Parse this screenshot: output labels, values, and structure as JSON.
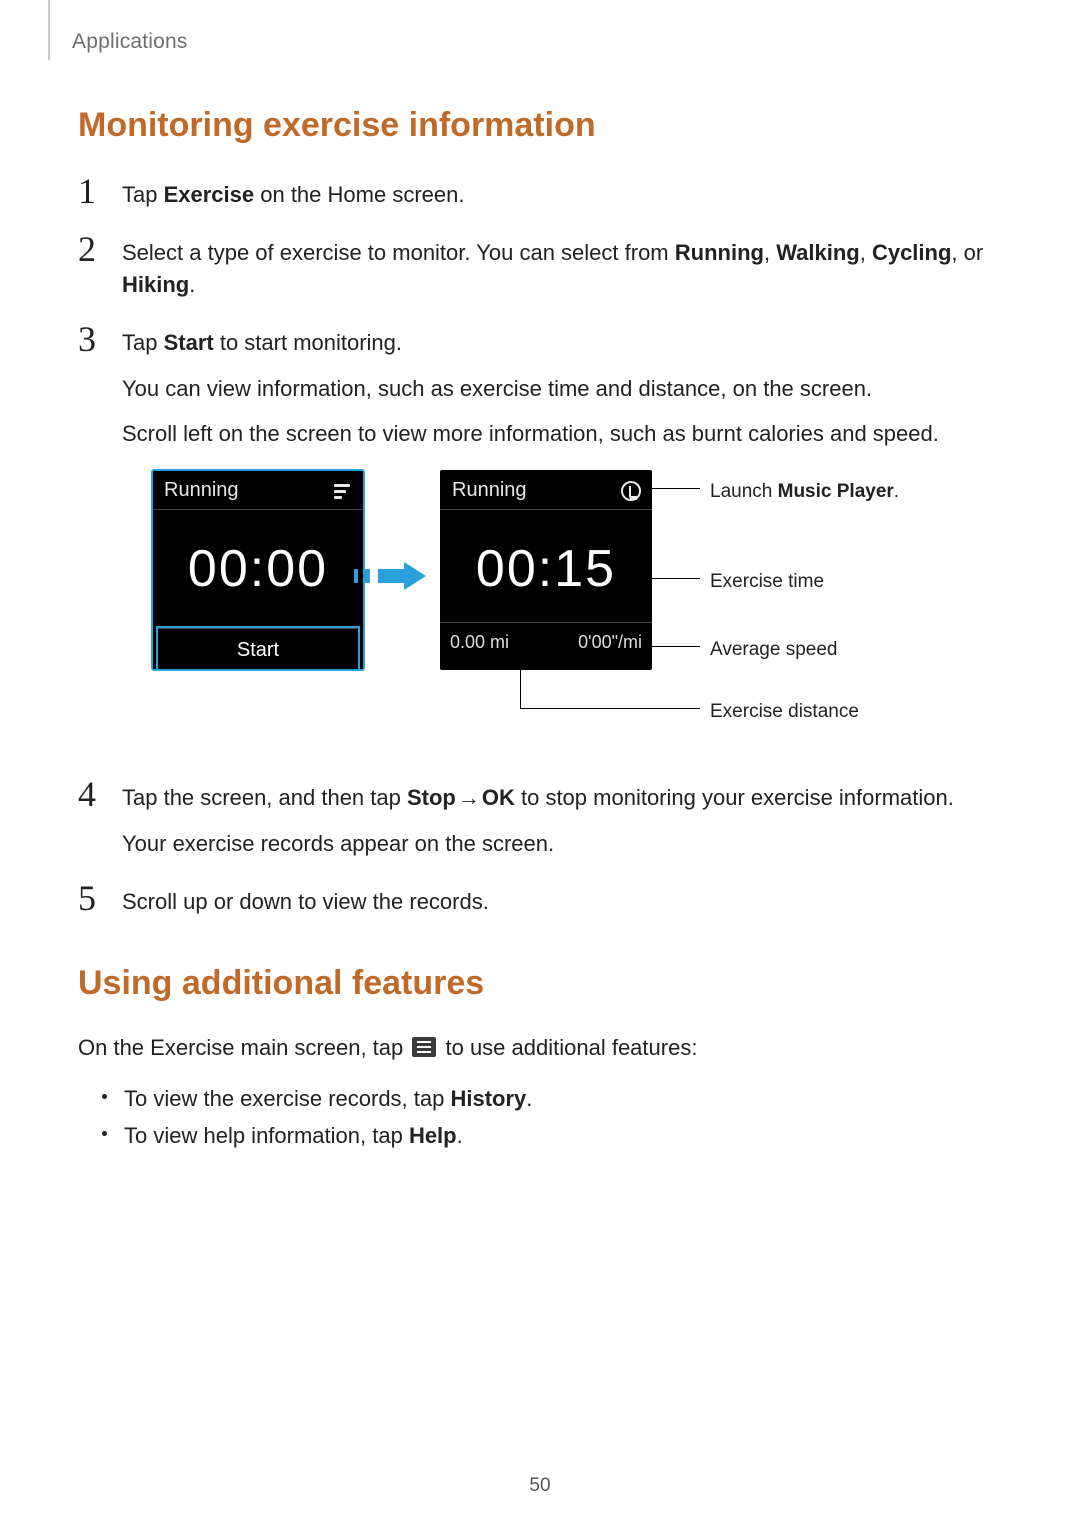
{
  "header": {
    "section": "Applications"
  },
  "h1": "Monitoring exercise information",
  "steps": {
    "s1": {
      "num": "1",
      "pre": "Tap ",
      "bold": "Exercise",
      "post": " on the Home screen."
    },
    "s2": {
      "num": "2",
      "pre": "Select a type of exercise to monitor. You can select from ",
      "b1": "Running",
      "c1": ", ",
      "b2": "Walking",
      "c2": ", ",
      "b3": "Cycling",
      "c3": ", or ",
      "b4": "Hiking",
      "post": "."
    },
    "s3": {
      "num": "3",
      "line1_pre": "Tap ",
      "line1_bold": "Start",
      "line1_post": " to start monitoring.",
      "line2": "You can view information, such as exercise time and distance, on the screen.",
      "line3": "Scroll left on the screen to view more information, such as burnt calories and speed."
    },
    "s4": {
      "num": "4",
      "pre": "Tap the screen, and then tap ",
      "b1": "Stop",
      "arrow": " → ",
      "b2": "OK",
      "post": " to stop monitoring your exercise information.",
      "line2": "Your exercise records appear on the screen."
    },
    "s5": {
      "num": "5",
      "text": "Scroll up or down to view the records."
    }
  },
  "figure": {
    "watch_left": {
      "title": "Running",
      "time": "00:00",
      "start": "Start"
    },
    "watch_right": {
      "title": "Running",
      "time": "00:15",
      "distance": "0.00 mi",
      "pace": "0'00\"/mi"
    },
    "callouts": {
      "music_pre": "Launch ",
      "music_bold": "Music Player",
      "music_post": ".",
      "time": "Exercise time",
      "speed": "Average speed",
      "distance": "Exercise distance"
    }
  },
  "h2b": "Using additional features",
  "features": {
    "intro_pre": "On the Exercise main screen, tap ",
    "intro_post": " to use additional features:",
    "li1_pre": "To view the exercise records, tap ",
    "li1_bold": "History",
    "li1_post": ".",
    "li2_pre": "To view help information, tap ",
    "li2_bold": "Help",
    "li2_post": "."
  },
  "page_number": "50"
}
